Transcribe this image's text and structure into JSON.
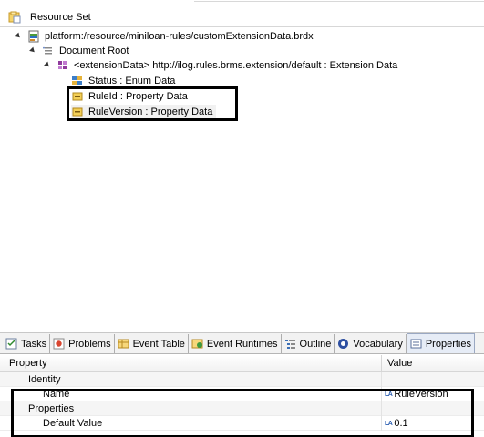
{
  "header": {
    "title": "Resource Set"
  },
  "tree": {
    "items": [
      {
        "label": "platform:/resource/miniloan-rules/customExtensionData.brdx",
        "icon": "brdx-file-icon"
      },
      {
        "label": "Document Root",
        "icon": "document-root-icon"
      },
      {
        "label": "<extensionData> http://ilog.rules.brms.extension/default : Extension Data",
        "icon": "extension-data-icon"
      },
      {
        "label": "Status : Enum Data",
        "icon": "enum-data-icon"
      },
      {
        "label": "RuleId : Property Data",
        "icon": "property-data-icon"
      },
      {
        "label": "RuleVersion : Property Data",
        "icon": "property-data-icon"
      }
    ]
  },
  "tabs": [
    {
      "label": "Tasks",
      "icon": "tasks-icon"
    },
    {
      "label": "Problems",
      "icon": "problems-icon"
    },
    {
      "label": "Event Table",
      "icon": "event-table-icon"
    },
    {
      "label": "Event Runtimes",
      "icon": "event-runtimes-icon"
    },
    {
      "label": "Outline",
      "icon": "outline-icon"
    },
    {
      "label": "Vocabulary",
      "icon": "vocabulary-icon"
    },
    {
      "label": "Properties",
      "icon": "properties-icon",
      "active": true
    }
  ],
  "properties": {
    "columns": {
      "property": "Property",
      "value": "Value"
    },
    "rows": [
      {
        "key": "Identity",
        "value": ""
      },
      {
        "key": "Name",
        "value": "RuleVersion",
        "value_icon": "text-attribute-icon"
      },
      {
        "key": "Properties",
        "value": ""
      },
      {
        "key": "Default Value",
        "value": "0.1",
        "value_icon": "text-attribute-icon"
      }
    ],
    "value_icon_text": "LA"
  },
  "colors": {
    "selection": "#f1f1f1",
    "active_tab": "#e6ecf6",
    "highlight_border": "#000000"
  }
}
